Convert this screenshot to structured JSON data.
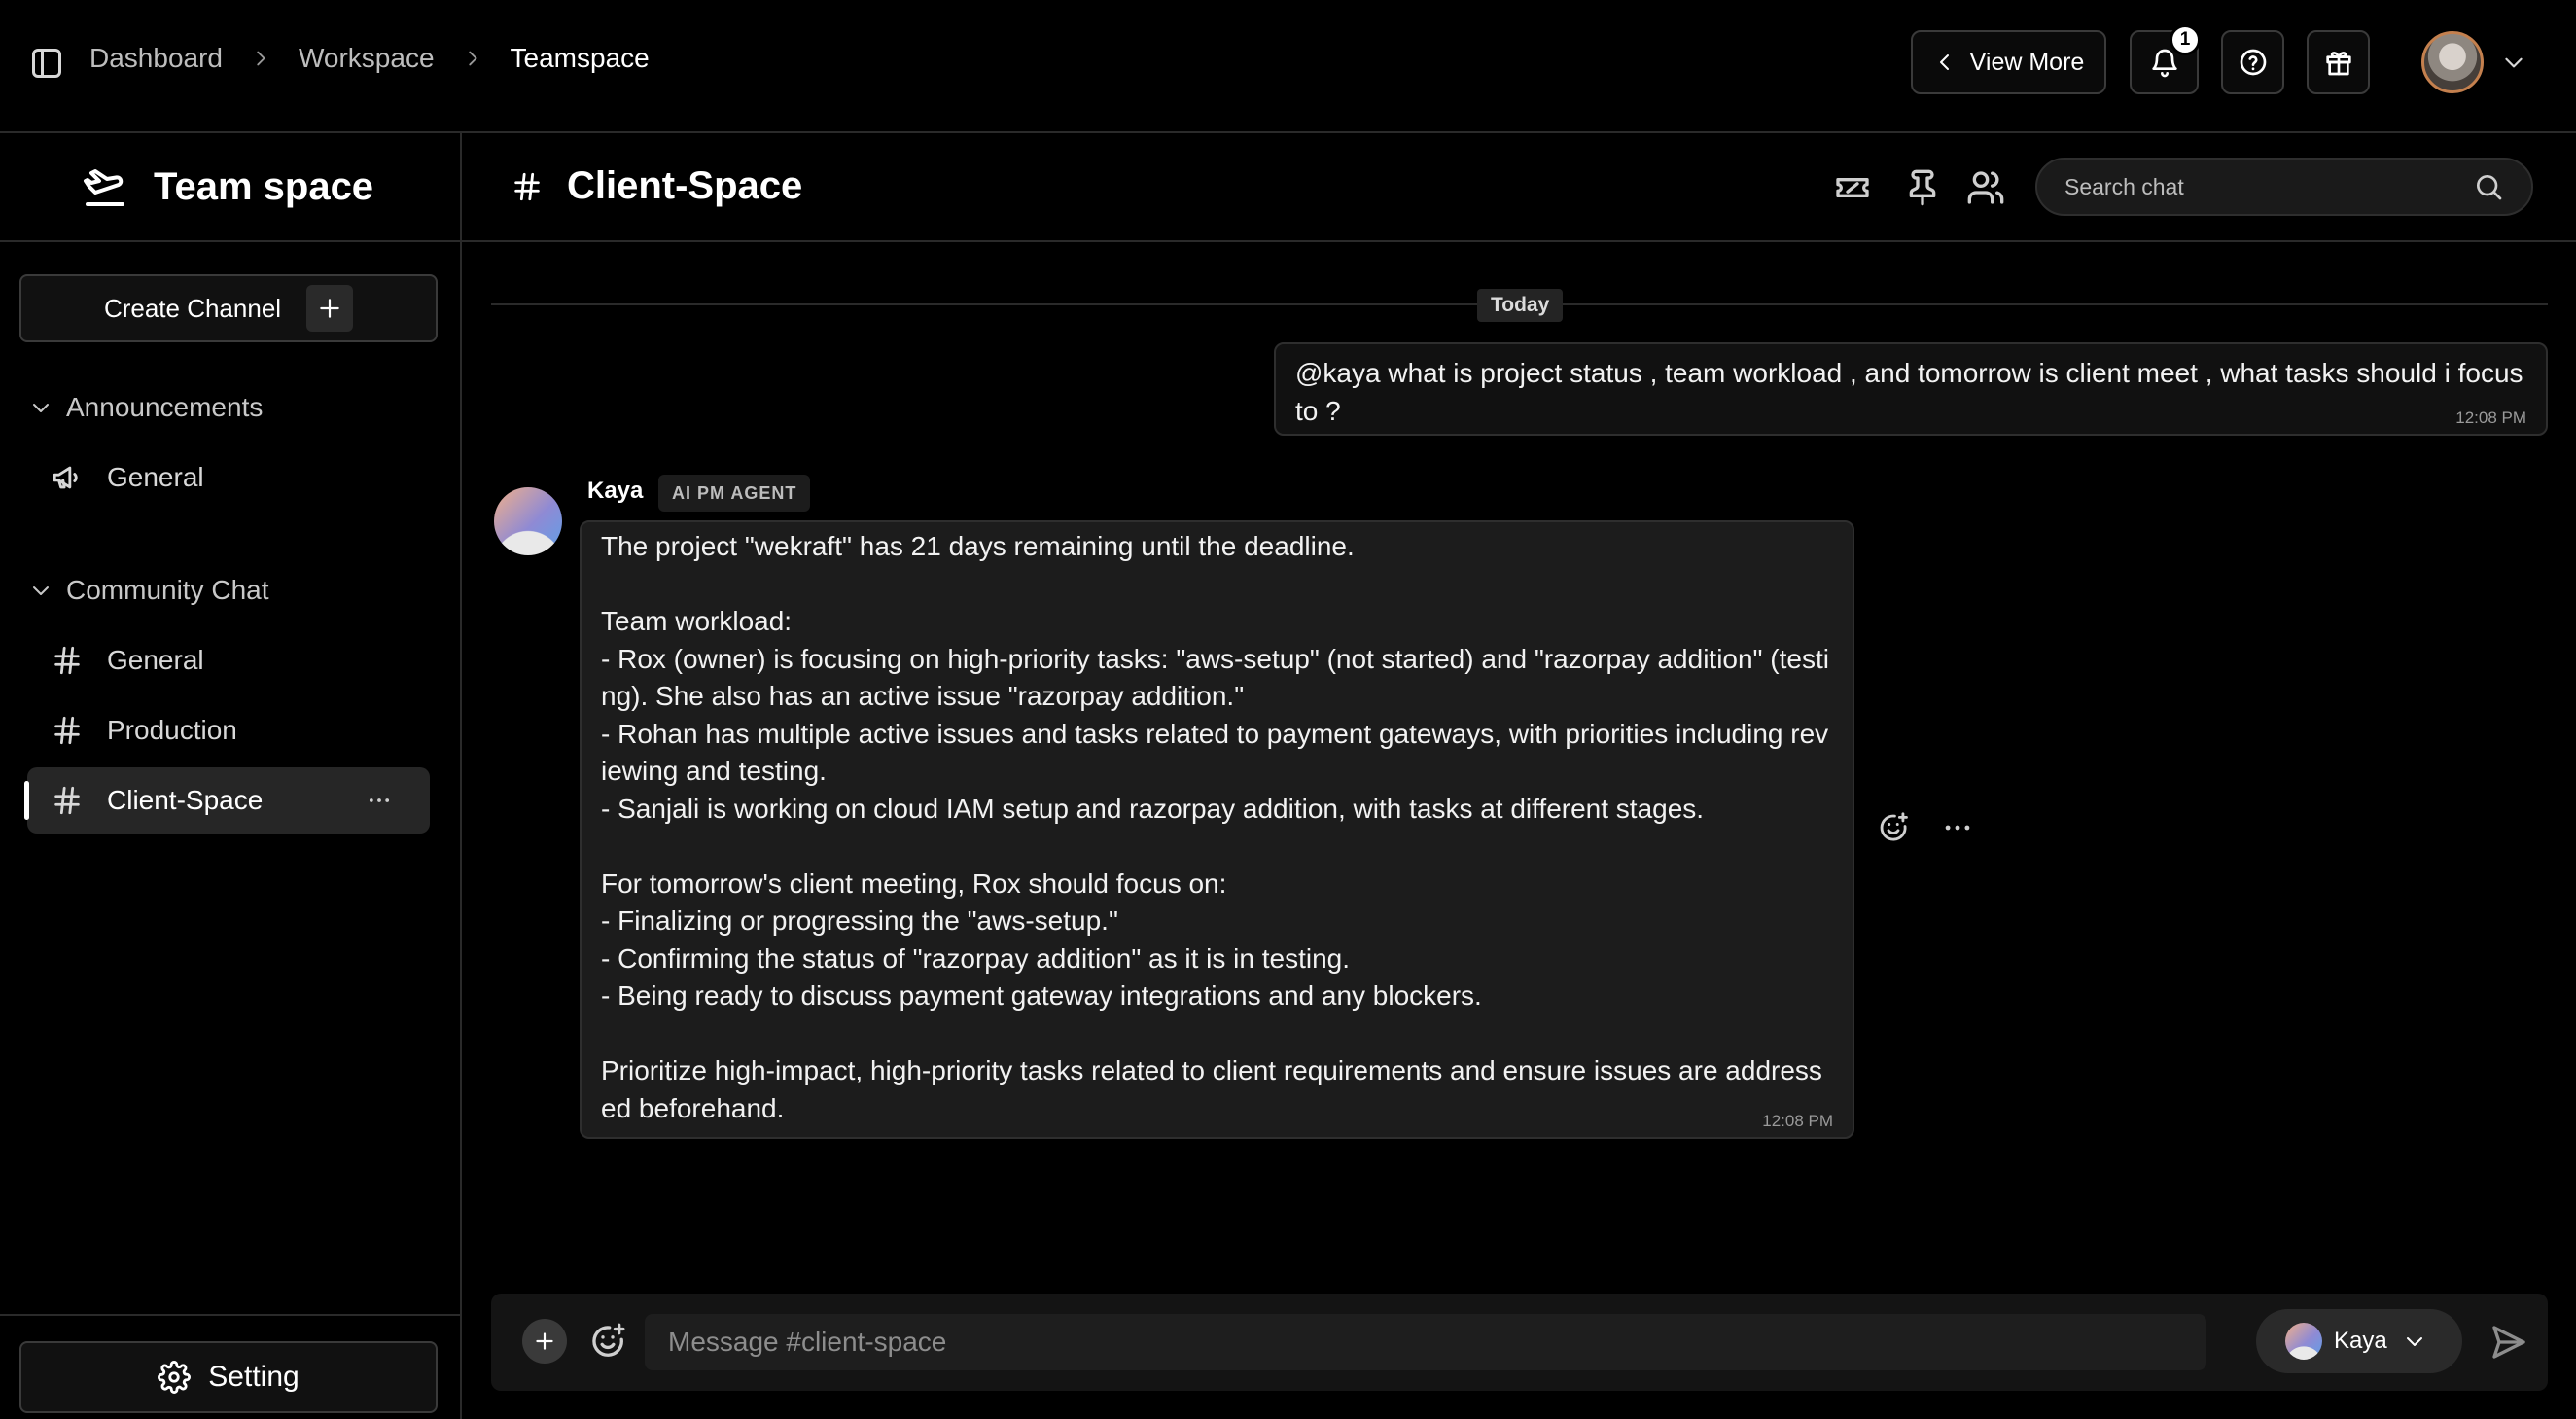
{
  "header": {
    "breadcrumb": [
      "Dashboard",
      "Workspace",
      "Teamspace"
    ],
    "view_more_label": "View More",
    "notification_count": "1"
  },
  "sidebar": {
    "title": "Team space",
    "create_channel_label": "Create Channel",
    "groups": [
      {
        "label": "Announcements",
        "channels": [
          {
            "label": "General",
            "icon": "megaphone-icon"
          }
        ]
      },
      {
        "label": "Community Chat",
        "channels": [
          {
            "label": "General",
            "icon": "hash-icon"
          },
          {
            "label": "Production",
            "icon": "hash-icon"
          },
          {
            "label": "Client-Space",
            "icon": "hash-icon",
            "active": true
          }
        ]
      }
    ],
    "setting_label": "Setting"
  },
  "channel": {
    "name": "Client-Space",
    "search_placeholder": "Search chat"
  },
  "messages": {
    "date_divider": "Today",
    "user_message": {
      "text": "@kaya what is project status , team workload , and tomorrow is client meet , what tasks should i focus to ?",
      "time": "12:08 PM"
    },
    "bot_message": {
      "sender": "Kaya",
      "tag": "AI PM AGENT",
      "text": "The project \"wekraft\" has 21 days remaining until the deadline.\n\nTeam workload:\n- Rox (owner) is focusing on high-priority tasks: \"aws-setup\" (not started) and \"razorpay addition\" (testing). She also has an active issue \"razorpay addition.\"\n- Rohan has multiple active issues and tasks related to payment gateways, with priorities including reviewing and testing.\n- Sanjali is working on cloud IAM setup and razorpay addition, with tasks at different stages.\n\nFor tomorrow's client meeting, Rox should focus on:\n- Finalizing or progressing the \"aws-setup.\"\n- Confirming the status of \"razorpay addition\" as it is in testing.\n- Being ready to discuss payment gateway integrations and any blockers.\n\nPrioritize high-impact, high-priority tasks related to client requirements and ensure issues are addressed beforehand.",
      "time": "12:08 PM"
    }
  },
  "composer": {
    "placeholder": "Message #client-space",
    "agent_label": "Kaya"
  },
  "colors": {
    "background": "#000000",
    "panel": "#1c1c1c",
    "border": "#2a2a2a",
    "active_channel": "#262626"
  }
}
